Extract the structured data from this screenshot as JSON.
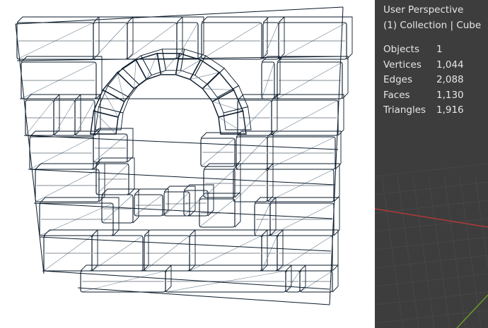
{
  "viewport": {
    "view_name": "User Perspective",
    "context": "(1) Collection | Cube",
    "stats": [
      {
        "label": "Objects",
        "value": "1"
      },
      {
        "label": "Vertices",
        "value": "1,044"
      },
      {
        "label": "Edges",
        "value": "2,088"
      },
      {
        "label": "Faces",
        "value": "1,130"
      },
      {
        "label": "Triangles",
        "value": "1,916"
      }
    ]
  },
  "colors": {
    "grid_background": "#3d3d3d",
    "grid_line": "#474747",
    "axis_x": "#b03a3a",
    "axis_y": "#6a9a2a",
    "mesh_background": "#ffffff",
    "wire_edge": "#0a1a2a",
    "wire_diagonal": "#6a7f92",
    "overlay_text": "#e6e6e6"
  }
}
